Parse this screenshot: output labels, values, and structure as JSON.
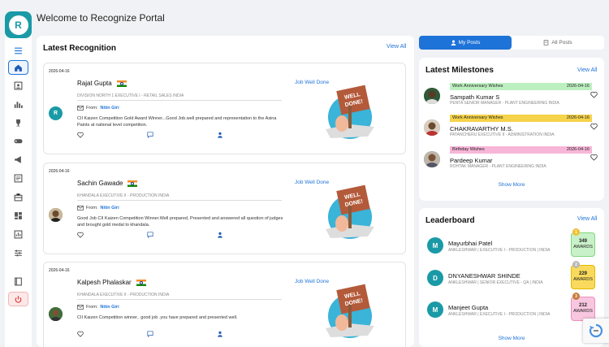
{
  "app": {
    "avatar_letter": "R",
    "page_title": "Welcome to Recognize Portal"
  },
  "sidebar": {
    "items": [
      "hamburger-icon",
      "home-icon",
      "badge-icon",
      "bar-chart-icon",
      "trophy-icon",
      "gamepad-icon",
      "megaphone-icon",
      "form-icon",
      "briefcase-icon",
      "dashboard-icon",
      "analytics-icon",
      "sliders-icon",
      "book-icon",
      "power-icon"
    ]
  },
  "latest": {
    "title": "Latest Recognition",
    "view_all": "View All",
    "items": [
      {
        "date": "2026-04-16",
        "name": "Rajat Gupta",
        "sub": "DIVISION NORTH 1 EXECUTIVE I - RETAIL SALES India",
        "from_label": "From:",
        "from": "Nitin Giri",
        "msg": "CII Kaizen Competition Gold Award Winner...Good Job.well prepared and representation to the Asina Paints at national level competition.",
        "badge": "Job Well Done",
        "avatar": "R"
      },
      {
        "date": "2026-04-16",
        "name": "Sachin Gawade",
        "sub": "KHANDALA EXECUTIVE II - PRODUCTION India",
        "from_label": "From:",
        "from": "Nitin Giri",
        "msg": "Good Job CII Kaizen Competition Winner.Well prepared, Presented and answered all question of judges and brought gold medal to khandala.",
        "badge": "Job Well Done",
        "avatar": ""
      },
      {
        "date": "2026-04-16",
        "name": "Kalpesh Phalaskar",
        "sub": "KHANDALA EXECUTIVE II - PRODUCTION India",
        "from_label": "From:",
        "from": "Nitin Giri",
        "msg": "CII Kaizen Competition winner.. good job .you have prepared and presented well.",
        "badge": "Job Well Done",
        "avatar": ""
      }
    ],
    "illus_text_1": "WELL",
    "illus_text_2": "DONE!"
  },
  "tabs": [
    {
      "label": "My Posts",
      "active": true
    },
    {
      "label": "All Posts",
      "active": false
    }
  ],
  "milestones": {
    "title": "Latest Milestones",
    "view_all": "View All",
    "items": [
      {
        "tag": "Work Anniversary Wishes",
        "date": "2026-04-16",
        "name": "Sampath Kumar S",
        "desc": "PENTA SENIOR MANAGER - PLANT ENGINEERING India",
        "color": "#bdf0c0"
      },
      {
        "tag": "Work Anniversary Wishes",
        "date": "2026-04-16",
        "name": "CHAKRAVARTHY M.S.",
        "desc": "PATANCHERU EXECUTIVE II - ADMINISTRATION India",
        "color": "#f5d34a"
      },
      {
        "tag": "Birthday Wishes",
        "date": "2026-04-16",
        "name": "Pardeep Kumar",
        "desc": "ROHTAK MANAGER - PLANT ENGINEERING India",
        "color": "#f7b6d8"
      }
    ],
    "show_more": "Show More"
  },
  "leaderboard": {
    "title": "Leaderboard",
    "view_all": "View All",
    "items": [
      {
        "avatar": "M",
        "name": "Mayurbhai Patel",
        "desc": "ANKLESHWAR | EXECUTIVE I - PRODUCTION | India",
        "count": "349",
        "label": "AWARDS",
        "rank": "1",
        "bg": "#c9f1c9",
        "border": "#7fd67f",
        "medal": "#f2c12e"
      },
      {
        "avatar": "D",
        "name": "DNYANESHWAR SHINDE",
        "desc": "ANKLESHWAR | SENIOR EXECUTIVE - QA | India",
        "count": "229",
        "label": "AWARDS",
        "rank": "2",
        "bg": "#f9da5c",
        "border": "#e4b800",
        "medal": "#b8b8b8"
      },
      {
        "avatar": "M",
        "name": "Manjeet Gupta",
        "desc": "ANKLESHWAR | EXECUTIVE I - PRODUCTION | India",
        "count": "212",
        "label": "AWARDS",
        "rank": "3",
        "bg": "#f8c7df",
        "border": "#ec8fbd",
        "medal": "#c77d3b"
      }
    ],
    "show_more": "Show More"
  }
}
